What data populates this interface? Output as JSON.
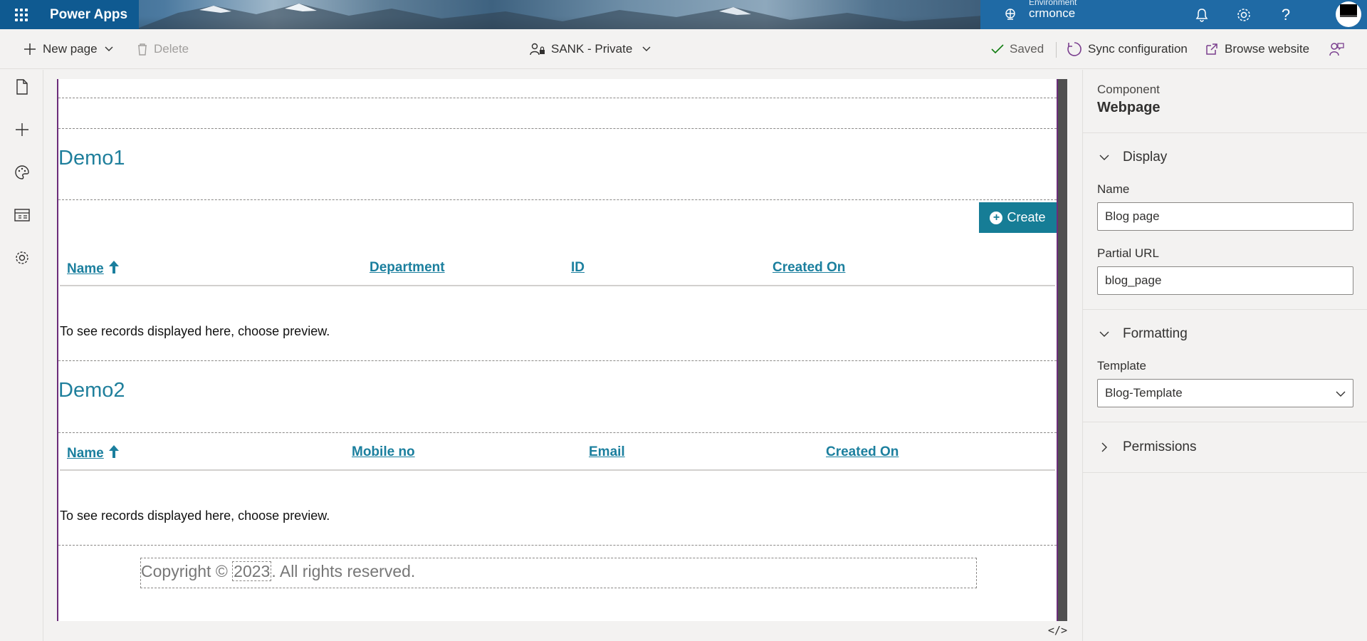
{
  "header": {
    "app_title": "Power Apps",
    "environment_label": "Environment",
    "environment_name": "crmonce"
  },
  "commandbar": {
    "new_page": "New page",
    "delete": "Delete",
    "site_name": "SANK - Private",
    "saved": "Saved",
    "sync": "Sync configuration",
    "browse": "Browse website"
  },
  "canvas": {
    "section1": {
      "title": "Demo1",
      "create_label": "Create",
      "columns": [
        "Name",
        "Department",
        "ID",
        "Created On"
      ],
      "empty_message": "To see records displayed here, choose preview."
    },
    "section2": {
      "title": "Demo2",
      "columns": [
        "Name",
        "Mobile no",
        "Email",
        "Created On"
      ],
      "empty_message": "To see records displayed here, choose preview."
    },
    "footer": {
      "copyright_prefix": "Copyright ©",
      "year": "2023",
      "copyright_suffix": ". All rights reserved."
    },
    "code_toggle": "</>"
  },
  "panel": {
    "component_kind": "Component",
    "component_name": "Webpage",
    "display_section": "Display",
    "name_label": "Name",
    "name_value": "Blog page",
    "partial_url_label": "Partial URL",
    "partial_url_value": "blog_page",
    "formatting_section": "Formatting",
    "template_label": "Template",
    "template_value": "Blog-Template",
    "permissions_section": "Permissions"
  },
  "colors": {
    "header_blue": "#1f6aa5",
    "accent_teal": "#167d96",
    "canvas_border": "#6b2c7a",
    "link_teal": "#1b7f9e"
  },
  "icons": [
    "waffle-icon",
    "environment-icon",
    "bell-icon",
    "gear-icon",
    "help-icon",
    "plus-icon",
    "trash-icon",
    "site-visibility-icon",
    "check-icon",
    "sync-icon",
    "open-external-icon",
    "feedback-icon",
    "pages-icon",
    "add-icon",
    "palette-icon",
    "data-icon",
    "settings-icon",
    "sort-up-icon",
    "chevron-down-icon",
    "chevron-right-icon"
  ]
}
